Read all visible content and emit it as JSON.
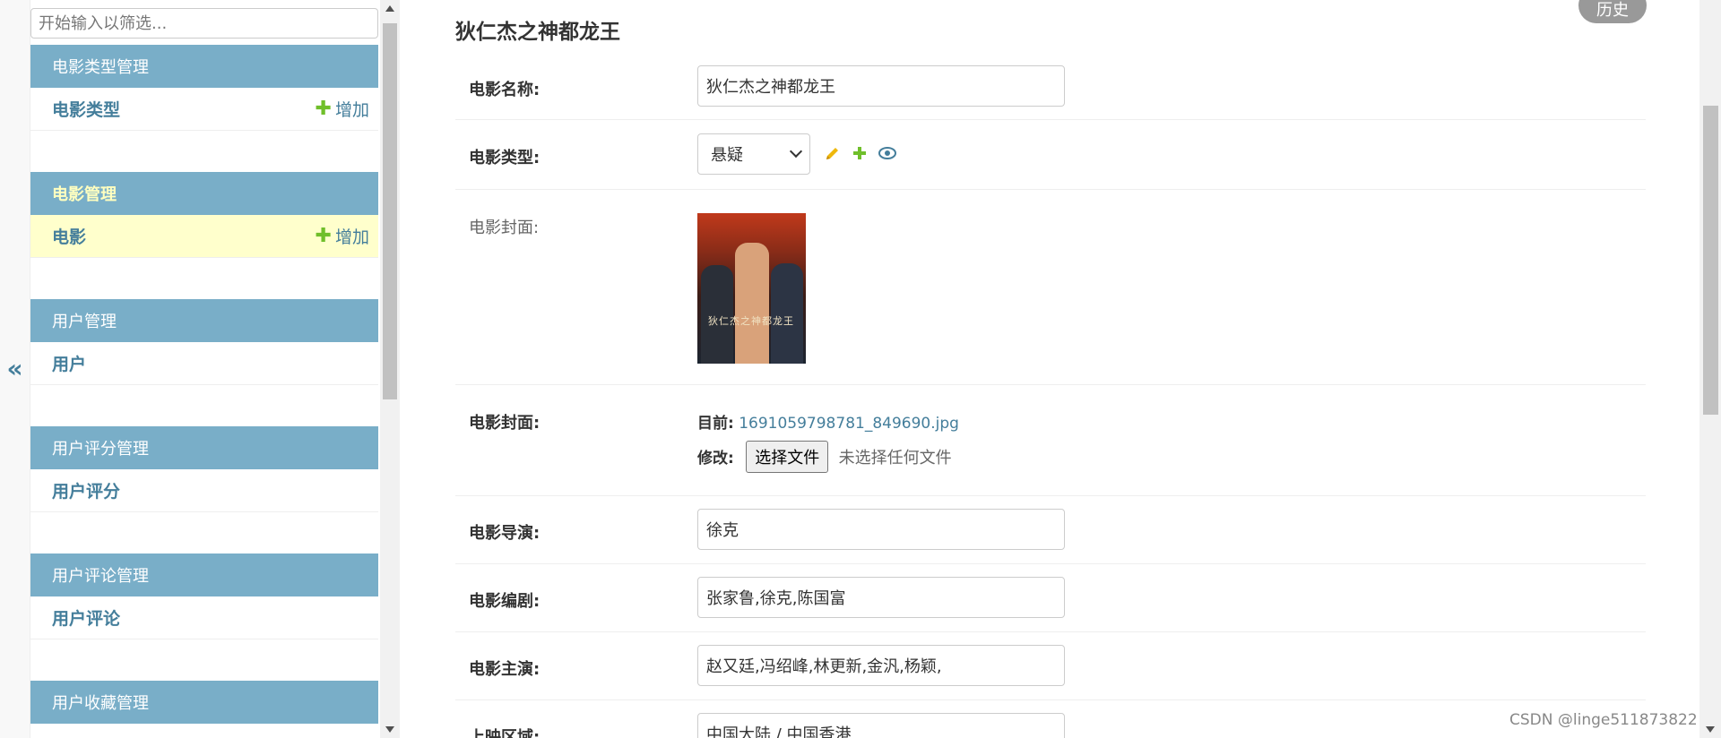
{
  "sidebar": {
    "filter_placeholder": "开始输入以筛选...",
    "toggle_glyph": "«",
    "modules": [
      {
        "header": "电影类型管理",
        "model": "电影类型",
        "add_label": "增加",
        "active": false
      },
      {
        "header": "电影管理",
        "model": "电影",
        "add_label": "增加",
        "active": true
      },
      {
        "header": "用户管理",
        "model": "用户",
        "add_label": null,
        "active": false
      },
      {
        "header": "用户评分管理",
        "model": "用户评分",
        "add_label": null,
        "active": false
      },
      {
        "header": "用户评论管理",
        "model": "用户评论",
        "add_label": null,
        "active": false
      },
      {
        "header": "用户收藏管理",
        "model": "",
        "add_label": null,
        "active": false
      }
    ]
  },
  "main": {
    "title": "狄仁杰之神都龙王",
    "history_label": "历史",
    "fields": {
      "name": {
        "label": "电影名称:",
        "value": "狄仁杰之神都龙王"
      },
      "genre": {
        "label": "电影类型:",
        "value": "悬疑"
      },
      "cover_preview": {
        "label": "电影封面:",
        "poster_text": "狄仁杰之神都龙王"
      },
      "cover": {
        "label": "电影封面:",
        "current_label": "目前:",
        "current_file": "1691059798781_849690.jpg",
        "change_label": "修改:",
        "choose_button": "选择文件",
        "no_file": "未选择任何文件"
      },
      "director": {
        "label": "电影导演:",
        "value": "徐克"
      },
      "writer": {
        "label": "电影编剧:",
        "value": "张家鲁,徐克,陈国富"
      },
      "cast": {
        "label": "电影主演:",
        "value": "赵又廷,冯绍峰,林更新,金汎,杨颖,"
      },
      "region": {
        "label": "上映区域:",
        "value": "中国大陆 / 中国香港"
      }
    }
  },
  "watermark": "CSDN @linge511873822",
  "colors": {
    "module_header": "#79aec8",
    "link": "#447e9b",
    "add_plus": "#70bf2b",
    "current_row": "#ffffcc",
    "edit_icon": "#efb80b",
    "view_icon": "#447e9b"
  }
}
